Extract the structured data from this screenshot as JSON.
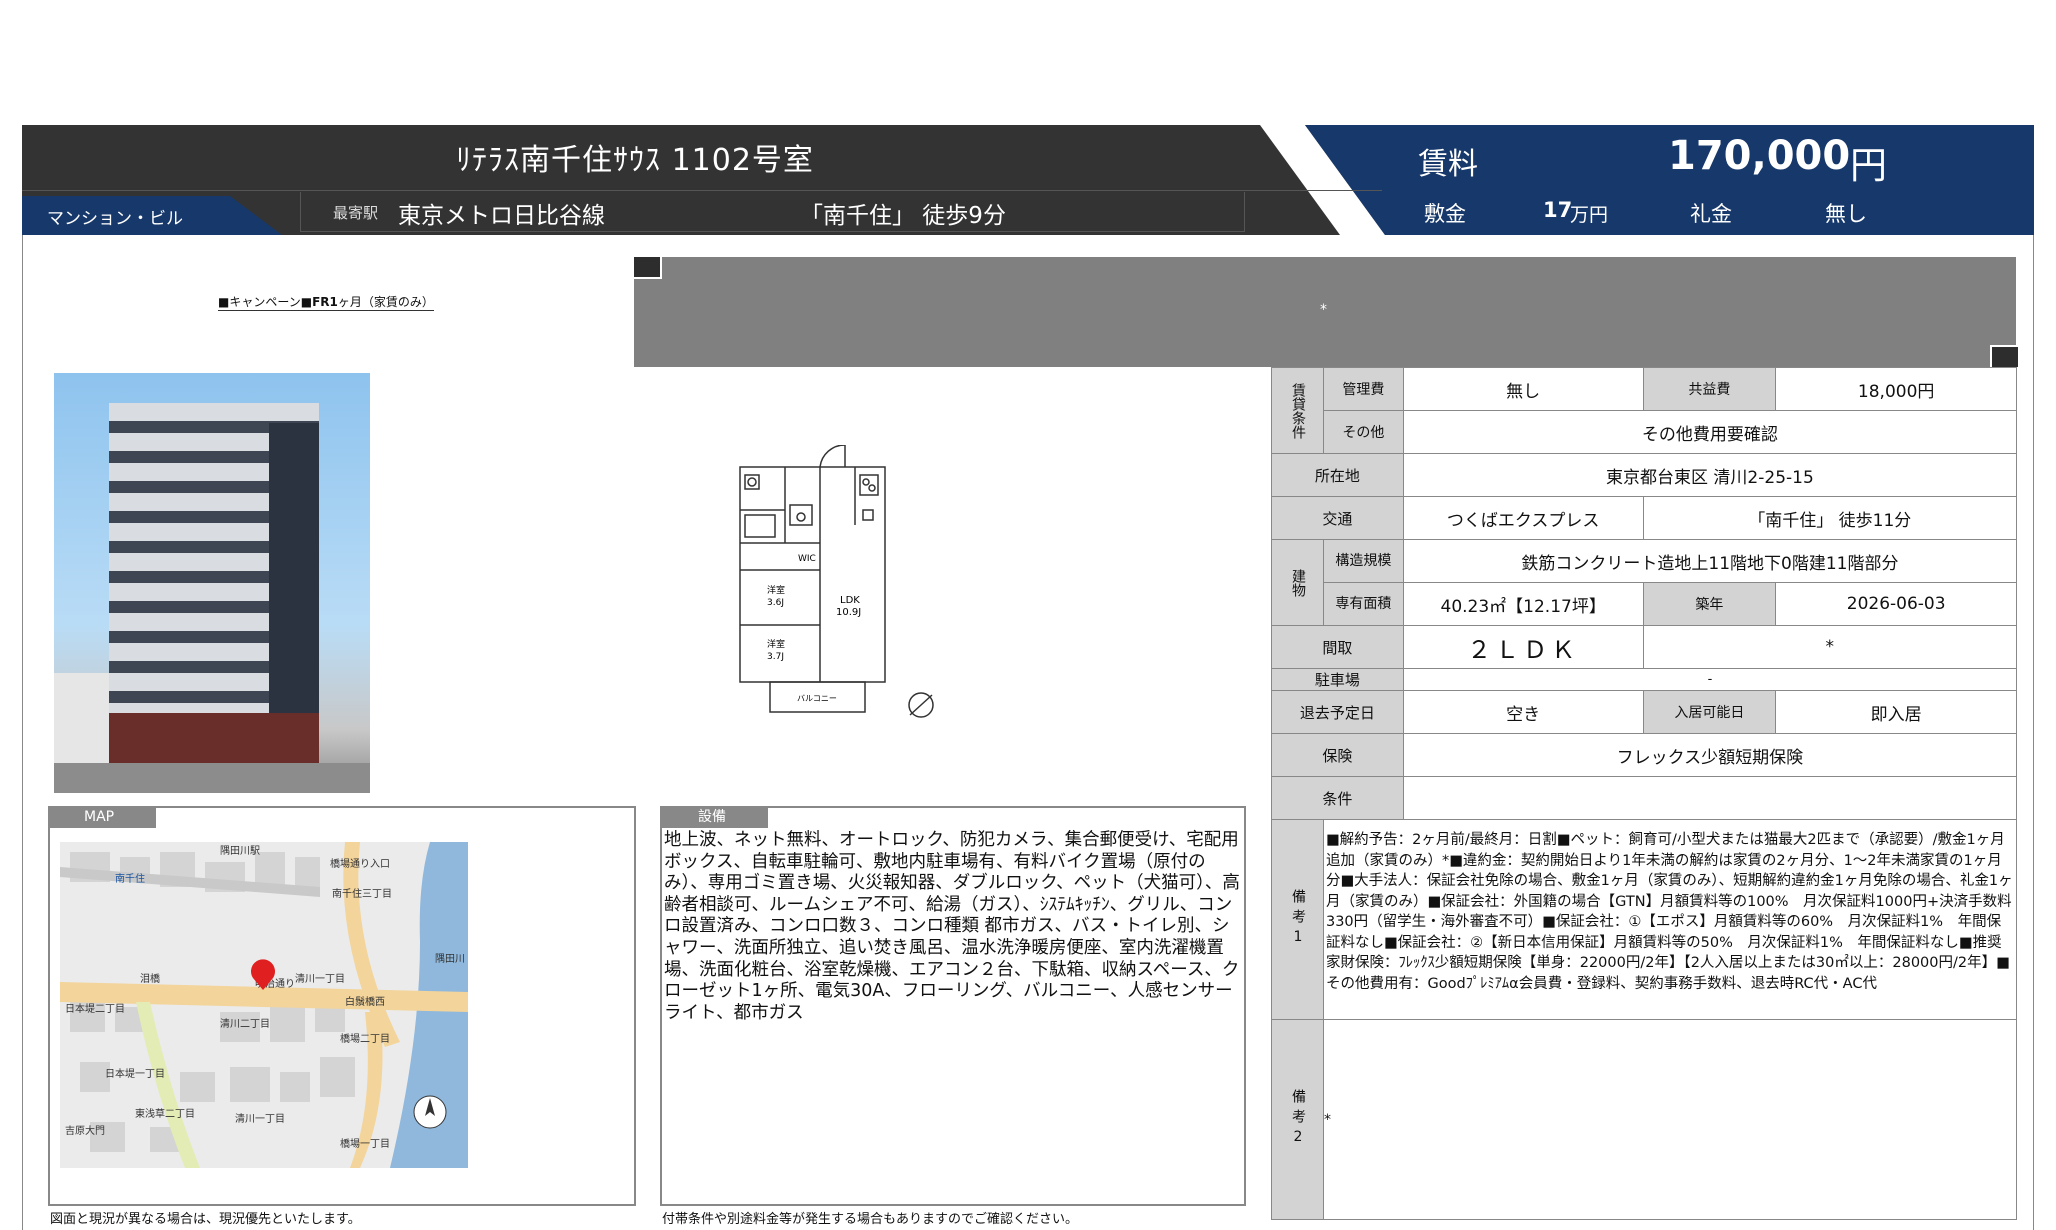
{
  "header": {
    "title": "ﾘﾃﾗｽ南千住ｻｳｽ 1102号室",
    "type": "マンション・ビル",
    "station_label": "最寄駅",
    "line": "東京メトロ日比谷線",
    "station_walk": "「南千住」 徒歩9分",
    "rent_label": "賃料",
    "rent_value": "170,000",
    "rent_unit": "円",
    "deposit_label": "敷金",
    "deposit_value": "17",
    "deposit_unit": "万円",
    "key_money_label": "礼金",
    "key_money_value": "無し"
  },
  "campaign": {
    "prefix": "■キャンペーン■",
    "bold": "FR1",
    "suffix": "ヶ月（家賃のみ）"
  },
  "banner": {
    "star": "*"
  },
  "floorplan": {
    "wic": "WIC",
    "room1": "洋室",
    "room1_size": "3.6J",
    "room2": "洋室",
    "room2_size": "3.7J",
    "ldk": "LDK",
    "ldk_size": "10.9J",
    "balcony": "バルコニー"
  },
  "map": {
    "tab": "MAP",
    "note": "図面と現況が異なる場合は、現況優先といたします。",
    "labels": [
      "隅田川駅",
      "南千住",
      "橋場通り入口",
      "南千住三丁目",
      "明治通り",
      "清川一丁目",
      "泪橋",
      "日本堤二丁目",
      "清川二丁目",
      "白鬚橋西",
      "橋場二丁目",
      "日本堤一丁目",
      "東浅草二丁目",
      "清川一丁目",
      "吉原大門",
      "橋場一丁目",
      "隅田川"
    ]
  },
  "equipment": {
    "tab": "設備",
    "text": "地上波、ネット無料、オートロック、防犯カメラ、集合郵便受け、宅配用ボックス、自転車駐輪可、敷地内駐車場有、有料バイク置場（原付のみ）、専用ゴミ置き場、火災報知器、ダブルロック、ペット（犬猫可）、高齢者相談可、ルームシェア不可、給湯（ガス）、ｼｽﾃﾑｷｯﾁﾝ、グリル、コンロ設置済み、コンロ口数３、コンロ種類 都市ガス、バス・トイレ別、シャワー、洗面所独立、追い焚き風呂、温水洗浄暖房便座、室内洗濯機置場、洗面化粧台、浴室乾燥機、エアコン２台、下駄箱、収納スペース、クローゼット1ヶ所、電気30A、フローリング、バルコニー、人感センサーライト、都市ガス",
    "note": "付帯条件や別途料金等が発生する場合もありますのでご確認ください。"
  },
  "spec": {
    "cond_label": "賃貸条件",
    "mgmt_label": "管理費",
    "mgmt_value": "無し",
    "common_label": "共益費",
    "common_value": "18,000円",
    "other_label": "その他",
    "other_value": "その他費用要確認",
    "address_label": "所在地",
    "address_value": "東京都台東区 清川2-25-15",
    "transport_label": "交通",
    "transport_line": "つくばエクスプレス",
    "transport_walk": "「南千住」 徒歩11分",
    "building_label": "建物",
    "structure_label": "構造規模",
    "structure_value": "鉄筋コンクリート造地上11階地下0階建11階部分",
    "area_label": "専有面積",
    "area_value": "40.23㎡【12.17坪】",
    "age_label": "築年",
    "age_value": "2026-06-03",
    "layout_label": "間取",
    "layout_value": "２ＬＤＫ",
    "layout_extra": "*",
    "parking_label": "駐車場",
    "parking_value": "-",
    "vacate_label": "退去予定日",
    "vacate_value": "空き",
    "movein_label": "入居可能日",
    "movein_value": "即入居",
    "insurance_label": "保険",
    "insurance_value": "フレックス少額短期保険",
    "conditions_label": "条件",
    "conditions_value": "",
    "note1_label": "備考1",
    "note1_value": "■解約予告：2ヶ月前/最終月：日割■ペット：飼育可/小型犬または猫最大2匹まで（承認要）/敷金1ヶ月追加（家賃のみ）*■違約金：契約開始日より1年未満の解約は家賃の2ヶ月分、1～2年未満家賃の1ヶ月分■大手法人：保証会社免除の場合、敷金1ヶ月（家賃のみ）、短期解約違約金1ヶ月免除の場合、礼金1ヶ月（家賃のみ）■保証会社：外国籍の場合【GTN】月額賃料等の100%　月次保証料1000円+決済手数料330円（留学生・海外審査不可）■保証会社：①【エポス】月額賃料等の60%　月次保証料1%　年間保証料なし■保証会社：②【新日本信用保証】月額賃料等の50%　月次保証料1%　年間保証料なし■推奨家財保険：ﾌﾚｯｸｽ少額短期保険【単身：22000円/2年】【2人入居以上または30㎡以上：28000円/2年】■その他費用有：Goodﾌﾟﾚﾐｱﾑα会員費・登録料、契約事務手数料、退去時RC代・AC代",
    "note2_label": "備考2",
    "note2_value": "*"
  }
}
